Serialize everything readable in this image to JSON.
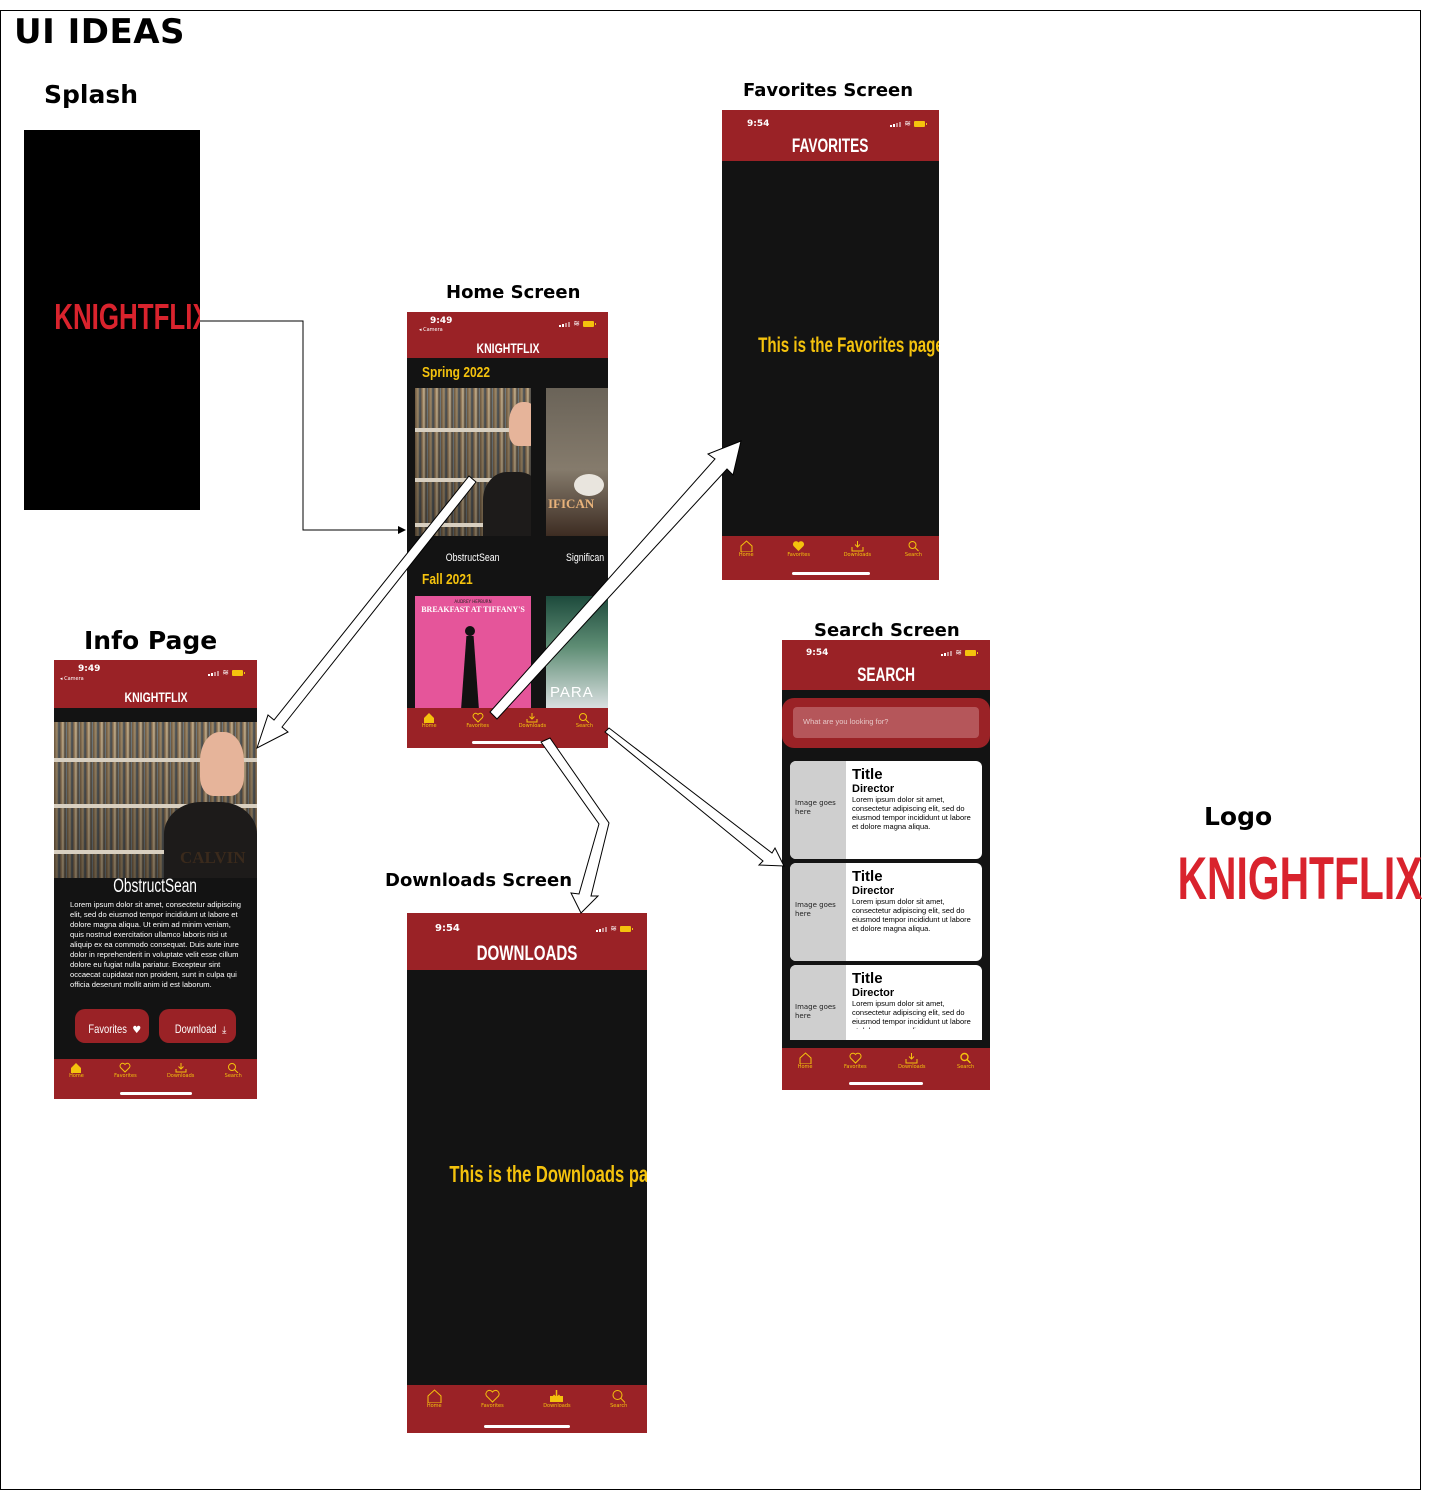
{
  "page_title": "UI IDEAS",
  "labels": {
    "splash": "Splash",
    "favorites": "Favorites Screen",
    "home": "Home Screen",
    "info": "Info Page",
    "search": "Search Screen",
    "downloads": "Downloads Screen",
    "logo": "Logo"
  },
  "brand": {
    "name": "KNIGHTFLIX",
    "red": "#d9232d",
    "nav_red": "#9a2226",
    "accent_yellow": "#f4c20d",
    "dark": "#131313"
  },
  "tabs": [
    "Home",
    "Favorites",
    "Downloads",
    "Search"
  ],
  "home": {
    "time": "9:49",
    "back": "◂ Camera",
    "section1": "Spring 2022",
    "section2": "Fall 2021",
    "movie1": "ObstructSean",
    "movie2": "Significan",
    "poster1_title": "BREAKFAST AT TIFFANY'S",
    "poster1_top": "AUDREY HEPBURN",
    "poster2_title": "PARA",
    "poster_sign": "IFICAN"
  },
  "favorites": {
    "time": "9:54",
    "title": "FAVORITES",
    "body": "This is the Favorites page"
  },
  "downloads": {
    "time": "9:54",
    "title": "DOWNLOADS",
    "body": "This is the Downloads page"
  },
  "search": {
    "time": "9:54",
    "title": "SEARCH",
    "placeholder": "What are you looking for?",
    "image_text": "Image goes here",
    "card_title": "Title",
    "card_director": "Director",
    "card_body": "Lorem ipsum dolor sit amet, consectetur adipiscing elit, sed do eiusmod tempor incididunt ut labore et dolore magna aliqua."
  },
  "info": {
    "time": "9:49",
    "back": "◂ Camera",
    "movie": "ObstructSean",
    "shirt_text": "CALVIN",
    "body": "Lorem ipsum dolor sit amet, consectetur adipiscing elit, sed do eiusmod tempor incididunt ut labore et dolore magna aliqua. Ut enim ad minim veniam, quis nostrud exercitation ullamco laboris nisi ut aliquip ex ea commodo consequat. Duis aute irure dolor in reprehenderit in voluptate velit esse cillum dolore eu fugiat nulla pariatur. Excepteur sint occaecat cupidatat non proident, sunt in culpa qui officia deserunt mollit anim id est laborum.",
    "btn_fav": "Favorites",
    "btn_dl": "Download"
  }
}
